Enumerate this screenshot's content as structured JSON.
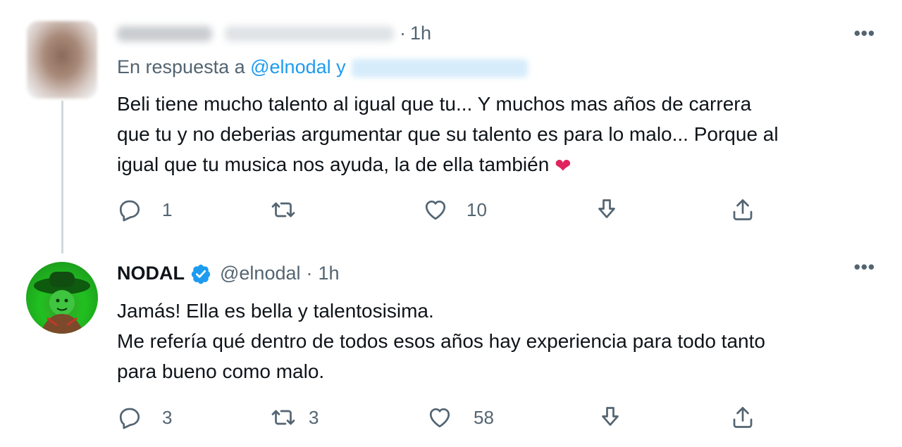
{
  "tweets": [
    {
      "time": "1h",
      "reply_prefix": "En respuesta a ",
      "reply_handle": "@elnodal",
      "reply_join": " y",
      "text_lines": [
        "Beli tiene mucho talento al igual que tu... Y muchos mas años de carrera",
        "que tu y no deberias argumentar que su talento es para lo malo... Porque al",
        "igual que tu musica nos ayuda, la de ella también"
      ],
      "emoji": "❤",
      "reply_count": "1",
      "retweet_count": "",
      "like_count": "10"
    },
    {
      "name": "NODAL",
      "handle": "@elnodal",
      "time": "1h",
      "text_lines": [
        "Jamás! Ella es bella y talentosisima.",
        "Me refería qué dentro de todos esos años hay experiencia para todo tanto",
        "para bueno como malo."
      ],
      "reply_count": "3",
      "retweet_count": "3",
      "like_count": "58"
    }
  ],
  "icons": {
    "reply": "reply-icon",
    "retweet": "retweet-icon",
    "like": "like-icon",
    "download": "download-icon",
    "share": "share-icon",
    "more": "more-icon",
    "verified": "verified-badge-icon"
  },
  "colors": {
    "link": "#1d9bf0",
    "muted": "#536471",
    "heart": "#e0245e",
    "thread_line": "#cfd9de"
  }
}
